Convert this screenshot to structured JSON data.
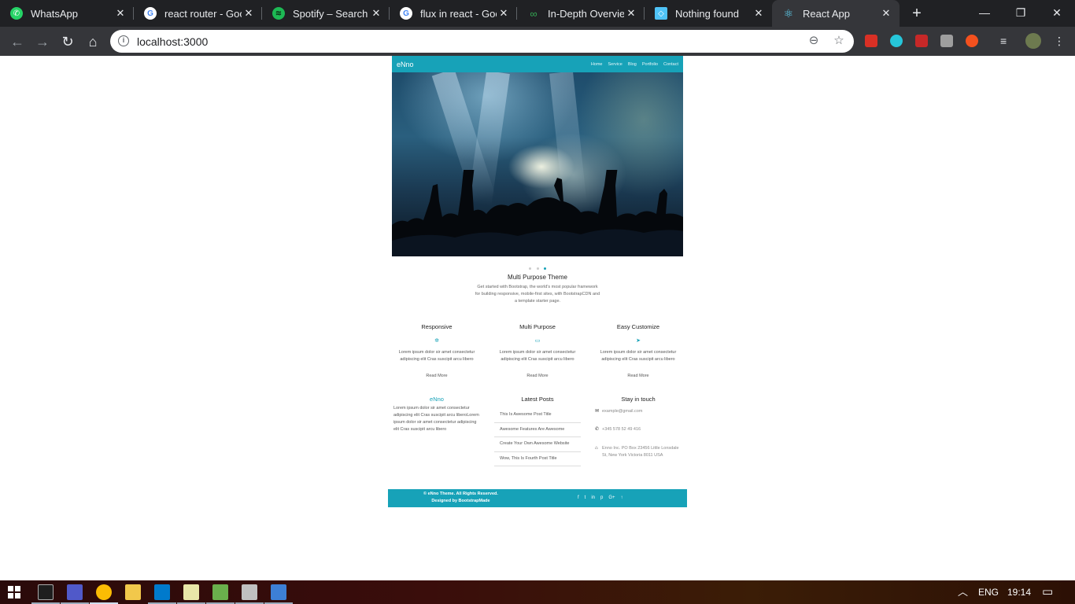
{
  "browser": {
    "tabs": [
      {
        "title": "WhatsApp",
        "favicon": "whatsapp-icon",
        "color": "#25d366"
      },
      {
        "title": "react router - Goo",
        "favicon": "google-icon",
        "color": "#ffffff"
      },
      {
        "title": "Spotify – Search",
        "favicon": "spotify-icon",
        "color": "#1db954"
      },
      {
        "title": "flux in react - Goo",
        "favicon": "google-icon",
        "color": "#ffffff"
      },
      {
        "title": "In-Depth Overview",
        "favicon": "link-icon",
        "color": "#34a853"
      },
      {
        "title": "Nothing found",
        "favicon": "diamond-icon",
        "color": "#4fc3f7"
      },
      {
        "title": "React App",
        "favicon": "react-icon",
        "color": "#61dafb"
      }
    ],
    "close_glyph": "✕",
    "url": "localhost:3000"
  },
  "site": {
    "brand": "eNno",
    "menu": [
      "Home",
      "Service",
      "Blog",
      "Portfolio",
      "Contact"
    ],
    "intro": {
      "title": "Multi Purpose Theme",
      "text": "Get started with Bootstrap, the world's most popular framework for building responsive, mobile-first sites, with BootstrapCDN and a template starter page."
    },
    "features": [
      {
        "title": "Responsive",
        "icon": "gear-icon",
        "text": "Lorem ipsum dolor sir amet consectetur adipiscing elit Cras suscipit arcu libero",
        "more": "Read More"
      },
      {
        "title": "Multi Purpose",
        "icon": "desktop-icon",
        "text": "Lorem ipsum dolor sir amet consectetur adipiscing elit Cras suscipit arcu libero",
        "more": "Read More"
      },
      {
        "title": "Easy Customize",
        "icon": "send-icon",
        "text": "Lorem ipsum dolor sir amet consectetur adipiscing elit Cras suscipit arcu libero",
        "more": "Read More"
      }
    ],
    "footer": {
      "about_title": "eNno",
      "about_text": "Lorem ipsum dolor sir amet consectetur adipiscing elit Cras suscipit arcu liberoLorem ipsum dolor sir amet consectetur adipiscing elit Cras suscipit arcu libero",
      "posts_title": "Latest Posts",
      "posts": [
        "This Is Awesome Post Title",
        "Awesome Features Are Awesome",
        "Create Your Own Awesome Website",
        "Wow, This Is Fourth Post Title"
      ],
      "contact_title": "Stay in touch",
      "email": "example@gmail.com",
      "phone": "+345 578 52 49 416",
      "address": "Enno Inc. PO Box 23456 Little Lonsdale St, New York Victoria 8011 USA",
      "copyright_line1": "©  eNno Theme. All Rights Reserved.",
      "copyright_line2": "Designed by BootstrapMade",
      "social": [
        "f",
        "t",
        "in",
        "p",
        "G+",
        "↑"
      ]
    },
    "accent_color": "#17a2b8"
  },
  "taskbar": {
    "language": "ENG",
    "time": "19:14"
  }
}
